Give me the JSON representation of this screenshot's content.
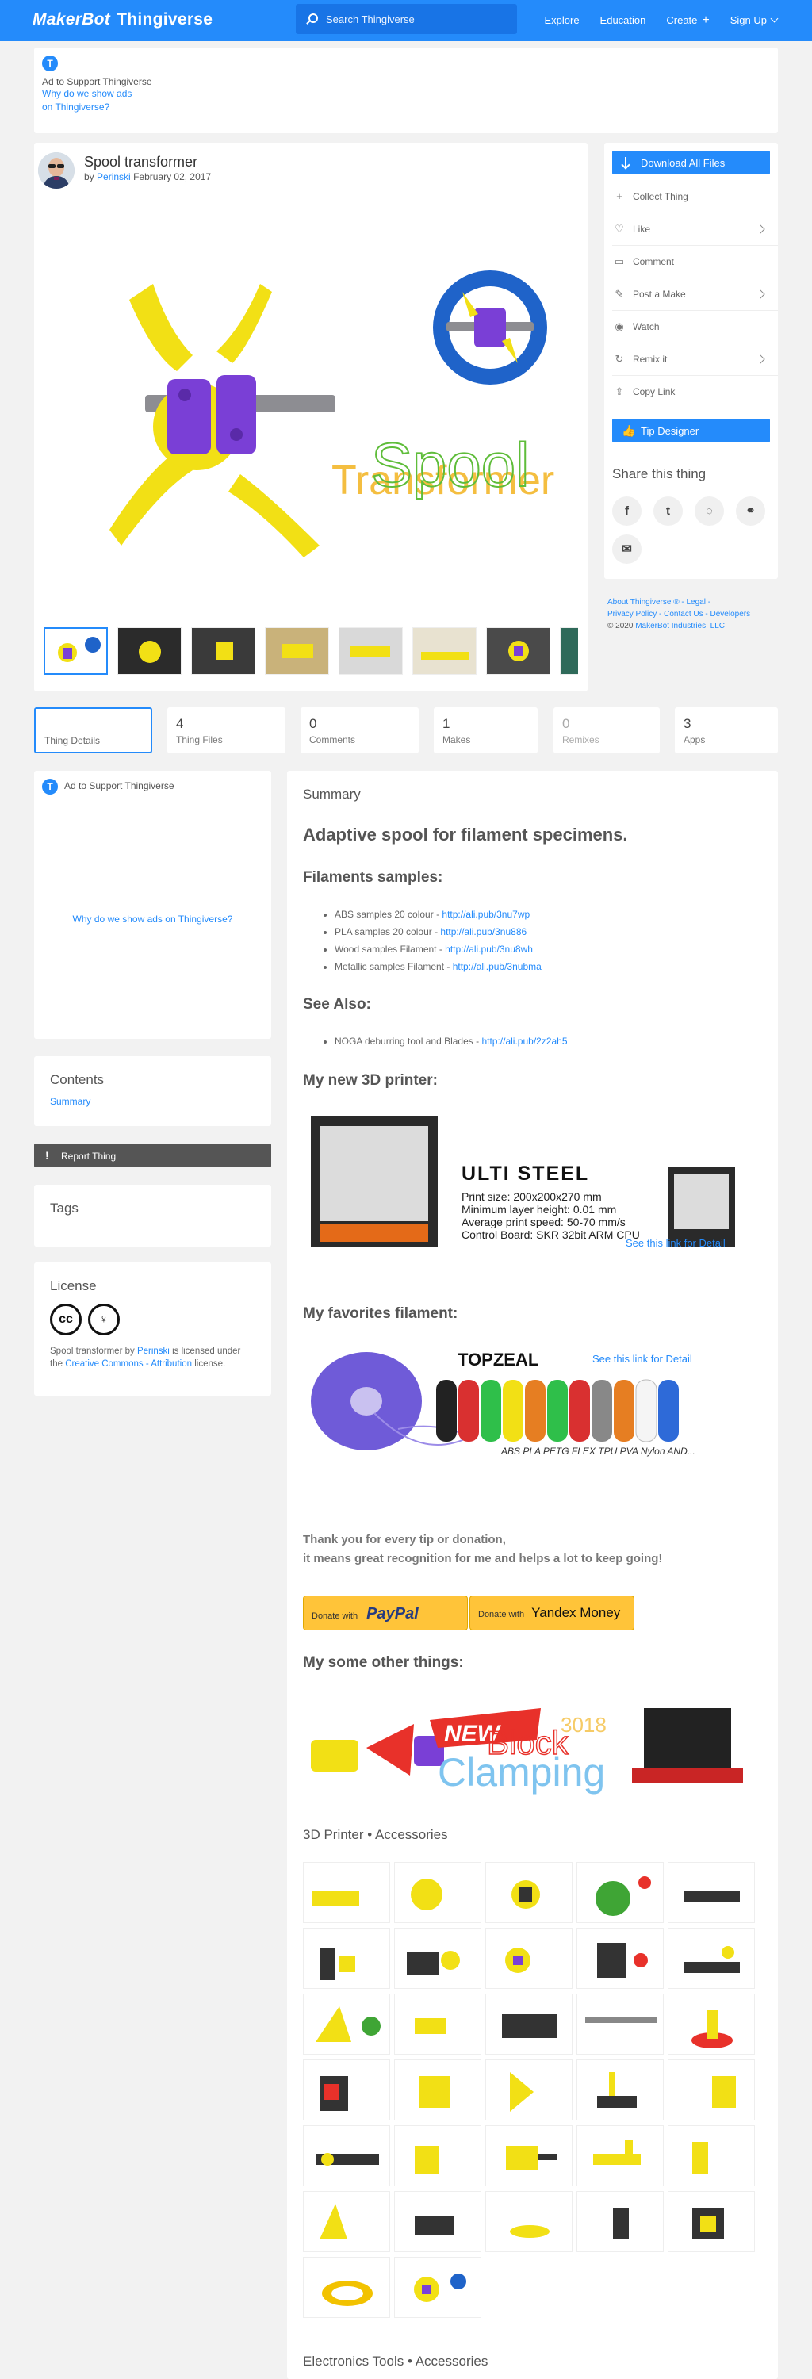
{
  "nav": {
    "brand_prefix": "MakerBot",
    "brand_name": "Thingiverse",
    "search_placeholder": "Search Thingiverse",
    "explore": "Explore",
    "education": "Education",
    "create": "Create",
    "signup": "Sign Up"
  },
  "top_ad": {
    "badge": "T",
    "support": "Ad to Support Thingiverse",
    "why": "Why do we show ads on Thingiverse?"
  },
  "thing": {
    "title": "Spool transformer",
    "by": "by",
    "author": "Perinski",
    "date": "February 02, 2017",
    "hero_text": "Transformer",
    "hero_text2": "Spool"
  },
  "actions": {
    "download": "Download All Files",
    "collect": "Collect Thing",
    "like": "Like",
    "comment": "Comment",
    "post_make": "Post a Make",
    "watch": "Watch",
    "remix": "Remix it",
    "copy_link": "Copy Link",
    "tip": "Tip Designer",
    "share_heading": "Share this thing"
  },
  "footer": {
    "about": "About Thingiverse ®",
    "legal": "Legal",
    "privacy": "Privacy Policy",
    "contact": "Contact Us",
    "developers": "Developers",
    "copyright": "© 2020",
    "company": "MakerBot Industries, LLC"
  },
  "tabs": [
    {
      "num": "",
      "label": "Thing Details"
    },
    {
      "num": "4",
      "label": "Thing Files"
    },
    {
      "num": "0",
      "label": "Comments"
    },
    {
      "num": "1",
      "label": "Makes"
    },
    {
      "num": "0",
      "label": "Remixes"
    },
    {
      "num": "3",
      "label": "Apps"
    }
  ],
  "left_ad": {
    "support": "Ad to Support Thingiverse",
    "why": "Why do we show ads on Thingiverse?"
  },
  "contents": {
    "heading": "Contents",
    "item": "Summary"
  },
  "report": "Report Thing",
  "tags": {
    "heading": "Tags"
  },
  "license": {
    "heading": "License",
    "text_a": "Spool transformer by",
    "author": "Perinski",
    "text_b": "is licensed under the",
    "license_link": "Creative Commons - Attribution",
    "text_c": "license."
  },
  "summary": {
    "heading": "Summary",
    "title": "Adaptive spool for filament specimens.",
    "filaments_heading": "Filaments samples:",
    "filaments": [
      {
        "text": "ABS samples 20 colour - ",
        "link": "http://ali.pub/3nu7wp"
      },
      {
        "text": "PLA samples 20 colour - ",
        "link": "http://ali.pub/3nu886"
      },
      {
        "text": "Wood samples Filament - ",
        "link": "http://ali.pub/3nu8wh"
      },
      {
        "text": "Metallic samples Filament - ",
        "link": "http://ali.pub/3nubma"
      }
    ],
    "see_also_heading": "See Also:",
    "see_also": [
      {
        "text": "NOGA deburring tool and Blades - ",
        "link": "http://ali.pub/2z2ah5"
      }
    ],
    "printer_heading": "My new 3D printer:",
    "printer_ad": {
      "name": "ULTI STEEL",
      "specs": [
        "Print size: 200x200x270 mm",
        "Minimum layer height: 0.01 mm",
        "Average print speed: 50-70 mm/s",
        "Control Board: SKR 32bit ARM CPU"
      ],
      "link": "See this link for Detail"
    },
    "filament_heading": "My favorites filament:",
    "filament_ad": {
      "brand": "TOPZEAL",
      "link": "See this link for Detail",
      "types": "ABS PLA PETG FLEX TPU PVA Nylon AND..."
    },
    "thanks_1": "Thank you for every tip or donation,",
    "thanks_2": "it means great recognition for me and helps a lot to keep going!",
    "donate_paypal_pre": "Donate with",
    "donate_paypal": "PayPal",
    "donate_yandex_pre": "Donate with",
    "donate_yandex": "Yandex Money",
    "other_heading": "My some other things:",
    "promo": {
      "new": "NEW",
      "block": "Block",
      "clamping": "Clamping",
      "cnc": "3018"
    },
    "accessories_heading": "3D Printer • Accessories",
    "electronics_heading": "Electronics Tools • Accessories"
  },
  "colors": {
    "accent": "#248bfb",
    "yellow": "#f2e015",
    "purple": "#7a3fd6"
  }
}
